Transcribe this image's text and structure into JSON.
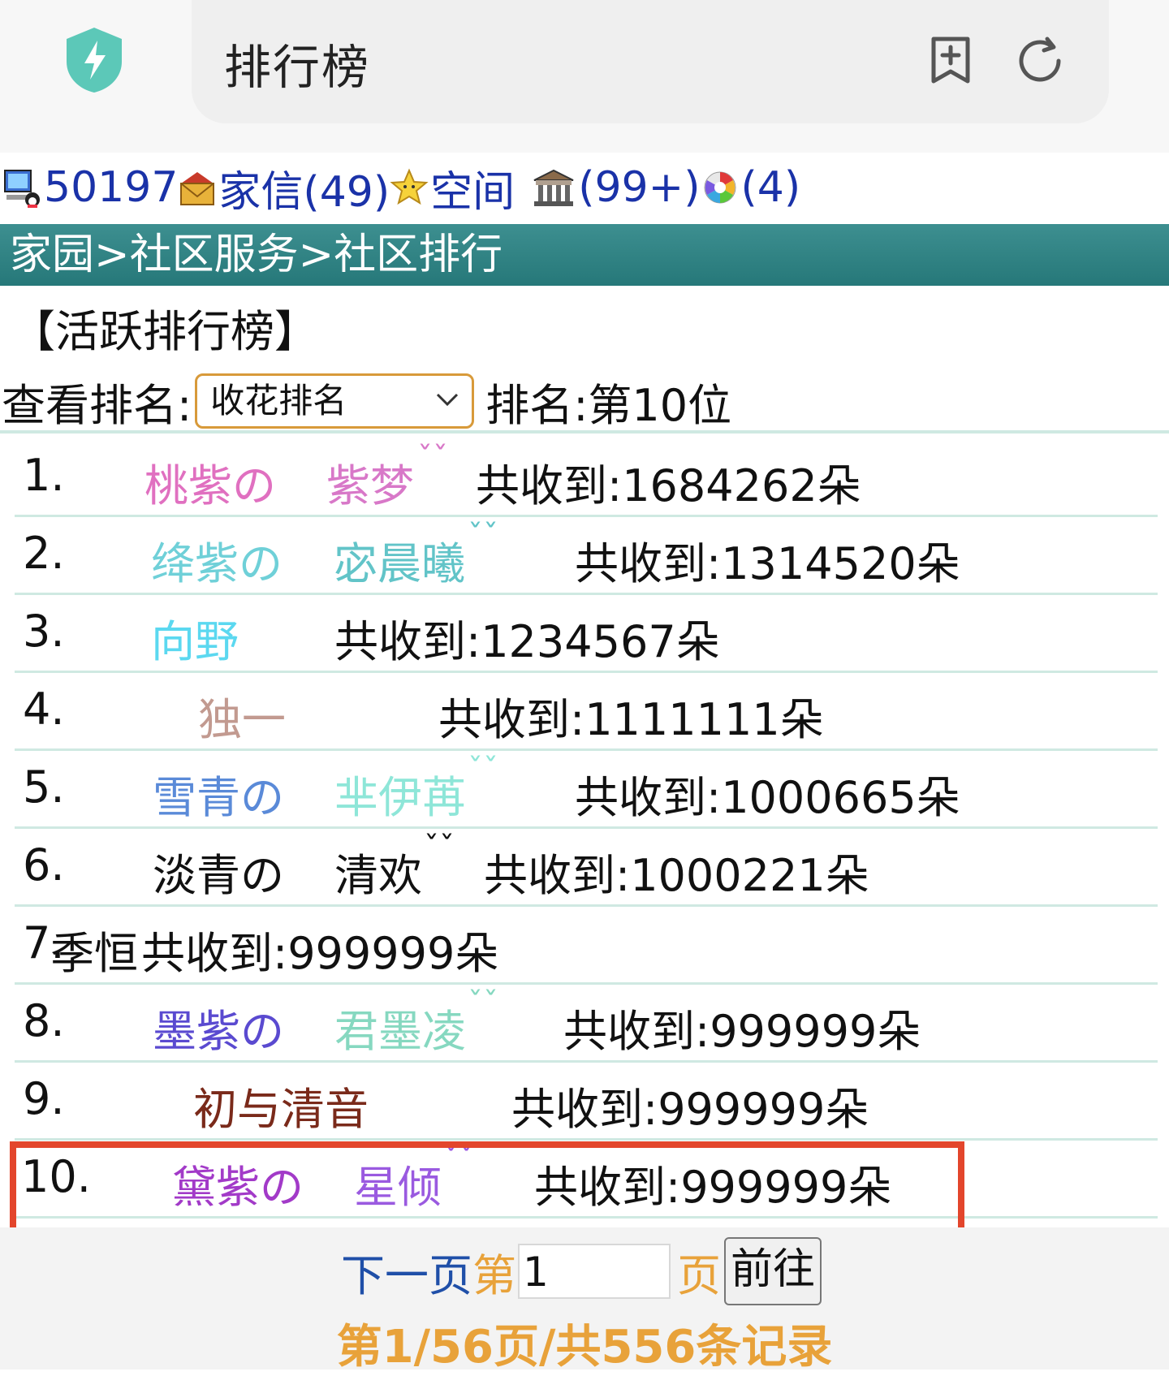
{
  "browser": {
    "title": "排行榜",
    "security_icon": "shield-bolt-icon",
    "bookmark_icon": "bookmark-add-icon",
    "refresh_icon": "refresh-icon"
  },
  "status_bar": {
    "user_id": "50197",
    "mail_label": "家信(49)",
    "space_label": "空间",
    "bank_count": "(99+)",
    "game_count": "(4)"
  },
  "breadcrumb": "家园>社区服务>社区排行",
  "heading": "【活跃排行榜】",
  "view": {
    "label": "查看排名:",
    "selected": "收花排名",
    "my_rank": "排名:第10位"
  },
  "rankings": [
    {
      "rank": "1.",
      "name_a": "桃紫の",
      "name_b": "紫梦",
      "mark": "ˇˇ",
      "total": "共收到:1684262朵",
      "color_a": "#e070c0",
      "color_b": "#d878c8"
    },
    {
      "rank": "2.",
      "name_a": "绛紫の",
      "name_b": "宓晨曦",
      "mark": "ˇˇ",
      "total": "共收到:1314520朵",
      "color_a": "#6fd0d8",
      "color_b": "#62c4c8"
    },
    {
      "rank": "3.",
      "name_a": "向野",
      "name_b": "",
      "mark": "",
      "total": "共收到:1234567朵",
      "color_a": "#5bd8f0",
      "color_b": "#5bd8f0"
    },
    {
      "rank": "4.",
      "name_a": "独一",
      "name_b": "",
      "mark": "",
      "total": "共收到:1111111朵",
      "color_a": "#c29a90",
      "color_b": "#c29a90"
    },
    {
      "rank": "5.",
      "name_a": "雪青の",
      "name_b": "芈伊苒",
      "mark": "ˇˇ",
      "total": "共收到:1000665朵",
      "color_a": "#5a8ad8",
      "color_b": "#8ee6d8"
    },
    {
      "rank": "6.",
      "name_a": "淡青の",
      "name_b": "清欢",
      "mark": "ˇˇ",
      "total": "共收到:1000221朵",
      "color_a": "#111111",
      "color_b": "#111111"
    },
    {
      "rank": "7.",
      "name_a": "季恒",
      "name_b": "",
      "mark": "",
      "total": "共收到:999999朵",
      "color_a": "#111111",
      "color_b": "#111111"
    },
    {
      "rank": "8.",
      "name_a": "墨紫の",
      "name_b": "君墨凌",
      "mark": "ˇˇ",
      "total": "共收到:999999朵",
      "color_a": "#5a4ad0",
      "color_b": "#86d8c0"
    },
    {
      "rank": "9.",
      "name_a": "初与清音",
      "name_b": "",
      "mark": "",
      "total": "共收到:999999朵",
      "color_a": "#7a2a1a",
      "color_b": "#7a2a1a"
    },
    {
      "rank": "10.",
      "name_a": "黛紫の",
      "name_b": "星倾",
      "mark": "ˇˇ",
      "total": "共收到:999999朵",
      "color_a": "#a23ac8",
      "color_b": "#9a5ae0"
    }
  ],
  "pager": {
    "next": "下一页",
    "page_prefix": "第",
    "page_value": "1",
    "page_suffix": "页",
    "go": "前往",
    "summary": "第1/56页/共556条记录"
  }
}
